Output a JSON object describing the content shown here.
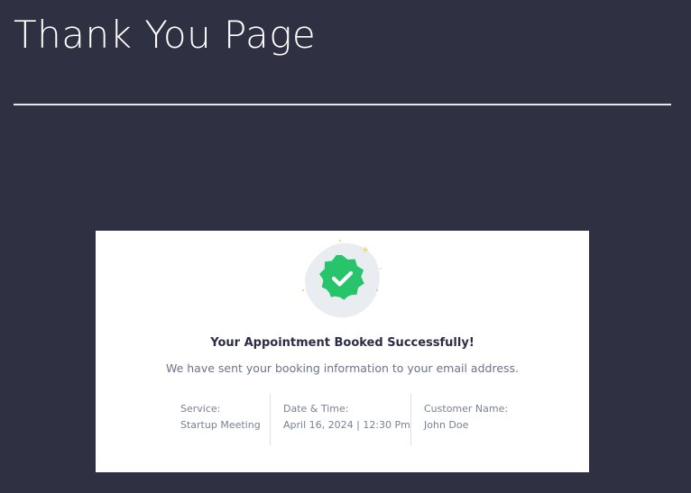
{
  "page": {
    "title": "Thank You Page"
  },
  "card": {
    "icon": "verified-check-badge-icon",
    "heading": "Your Appointment Booked Successfully!",
    "subtext": "We have sent your booking information to your email address.",
    "details": [
      {
        "label": "Service:",
        "value": "Startup Meeting"
      },
      {
        "label": "Date & Time:",
        "value": "April 16, 2024 | 12:30 Pm"
      },
      {
        "label": "Customer Name:",
        "value": "John Doe"
      }
    ]
  },
  "colors": {
    "background": "#2f3142",
    "card": "#ffffff",
    "success_green": "#27c46b",
    "badge_bg": "#e9edf2",
    "sparkle": "#f2c94c"
  }
}
